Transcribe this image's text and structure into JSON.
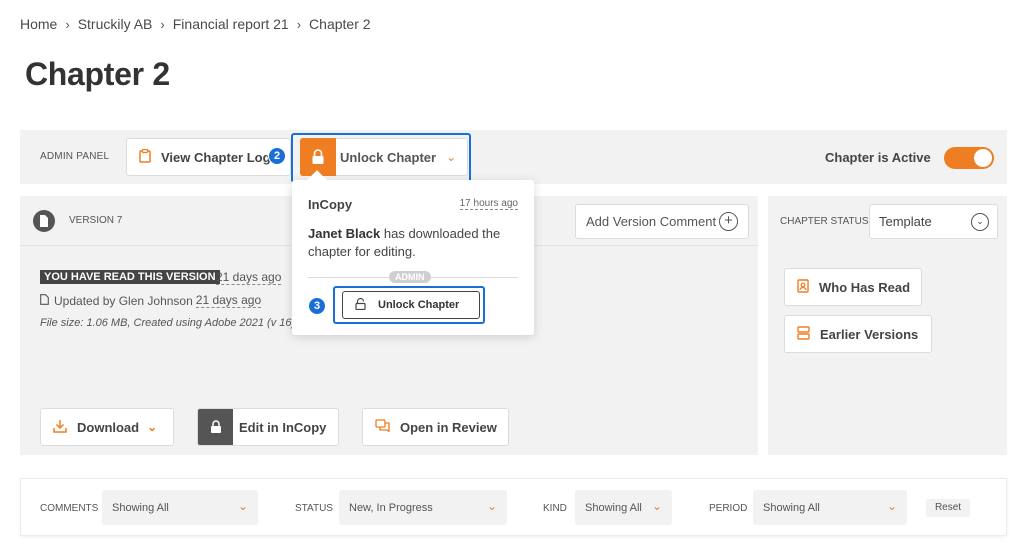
{
  "breadcrumb": [
    "Home",
    "Struckily AB",
    "Financial report 21",
    "Chapter 2"
  ],
  "page_title": "Chapter 2",
  "admin_panel": {
    "label": "ADMIN PANEL",
    "view_log_label": "View Chapter Log",
    "unlock_label": "Unlock Chapter",
    "active_label": "Chapter is Active",
    "active": true,
    "accent_color": "#ef7d22"
  },
  "steps": {
    "unlock_dropdown": "2",
    "unlock_action": "3"
  },
  "version": {
    "label": "VERSION 7",
    "add_comment_label": "Add Version Comment",
    "read_badge": "YOU HAVE READ THIS VERSION",
    "read_ago": "21 days ago",
    "updated_by": "Updated by Glen Johnson",
    "updated_ago": "21 days ago",
    "file_info": "File size: 1.06 MB, Created using Adobe 2021 (v 16)",
    "download_label": "Download",
    "edit_label": "Edit in InCopy",
    "review_label": "Open in Review"
  },
  "chapter_status": {
    "label": "CHAPTER STATUS",
    "selected": "Template",
    "who_has_read_label": "Who Has Read",
    "earlier_versions_label": "Earlier Versions"
  },
  "popover": {
    "app": "InCopy",
    "time": "17 hours ago",
    "user": "Janet Black",
    "message": " has downloaded the chapter for editing.",
    "admin_tag": "ADMIN",
    "unlock_label": "Unlock Chapter"
  },
  "filters": {
    "comments_label": "COMMENTS",
    "comments_value": "Showing All",
    "status_label": "STATUS",
    "status_value": "New, In Progress",
    "kind_label": "KIND",
    "kind_value": "Showing All",
    "period_label": "PERIOD",
    "period_value": "Showing All",
    "reset_label": "Reset"
  }
}
